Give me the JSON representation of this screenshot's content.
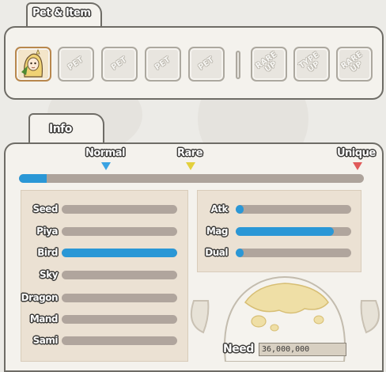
{
  "pet_item": {
    "tab_label": "Pet & Item",
    "slots": [
      "PET",
      "PET",
      "PET",
      "PET"
    ],
    "upgrade_slots": [
      "RARE UP",
      "TYPE UP",
      "RARE UP"
    ]
  },
  "info": {
    "tab_label": "Info",
    "rarity": {
      "labels": [
        "Normal",
        "Rare",
        "Unique"
      ],
      "marker_colors": [
        "#3aa3e2",
        "#e3d03c",
        "#e05a5a"
      ],
      "progress": 0.08
    },
    "types": [
      {
        "name": "Seed",
        "value": 0
      },
      {
        "name": "Piya",
        "value": 0
      },
      {
        "name": "Bird",
        "value": 1.0
      },
      {
        "name": "Sky",
        "value": 0
      },
      {
        "name": "Dragon",
        "value": 0
      },
      {
        "name": "Mand",
        "value": 0
      },
      {
        "name": "Sami",
        "value": 0
      }
    ],
    "stats": [
      {
        "name": "Atk",
        "value": 0.07
      },
      {
        "name": "Mag",
        "value": 0.85
      },
      {
        "name": "Dual",
        "value": 0.07
      }
    ],
    "need": {
      "label": "Need",
      "value": "36,000,000"
    }
  }
}
